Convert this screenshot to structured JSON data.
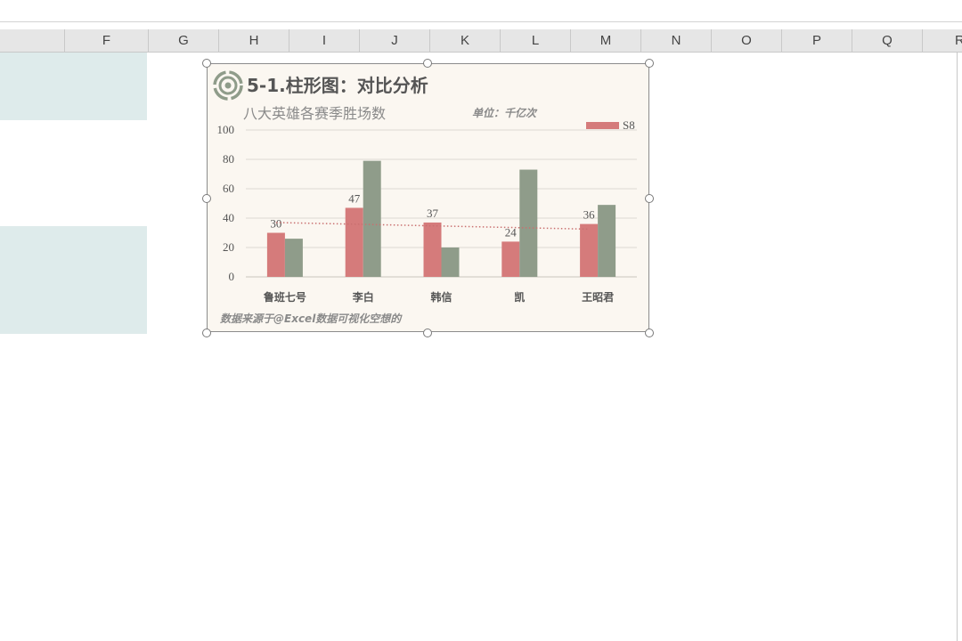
{
  "spreadsheet": {
    "columns": [
      "F",
      "G",
      "H",
      "I",
      "J",
      "K",
      "L",
      "M",
      "N",
      "O",
      "P",
      "Q",
      "R"
    ]
  },
  "chart": {
    "title": "5-1.柱形图：对比分析",
    "subtitle": "八大英雄各赛季胜场数",
    "unit_note": "单位：千亿次",
    "source": "数据来源于@Excel数据可视化空想的",
    "logo_icon": "target-circle-logo-icon"
  },
  "colors": {
    "series1": "#d57b7b",
    "series2": "#8f9c8a",
    "trend": "#c97070",
    "gridline": "#dedad4",
    "chart_bg": "#fbf7f1",
    "teal_cells": "#deebeb"
  },
  "chart_data": {
    "type": "bar",
    "categories": [
      "鲁班七号",
      "李白",
      "韩信",
      "凯",
      "王昭君"
    ],
    "series": [
      {
        "name": "S8",
        "values": [
          30,
          47,
          37,
          24,
          36
        ]
      },
      {
        "values": [
          26,
          79,
          20,
          73,
          49
        ]
      }
    ],
    "data_labels": [
      30,
      47,
      37,
      24,
      36
    ],
    "trendline": {
      "series": "S8",
      "style": "dotted",
      "start": 37,
      "end": 32.5
    },
    "ylim": [
      0,
      100
    ],
    "yticks": [
      0,
      20,
      40,
      60,
      80,
      100
    ],
    "grid": true,
    "legend": "top-right",
    "xlabel": "",
    "ylabel": ""
  }
}
